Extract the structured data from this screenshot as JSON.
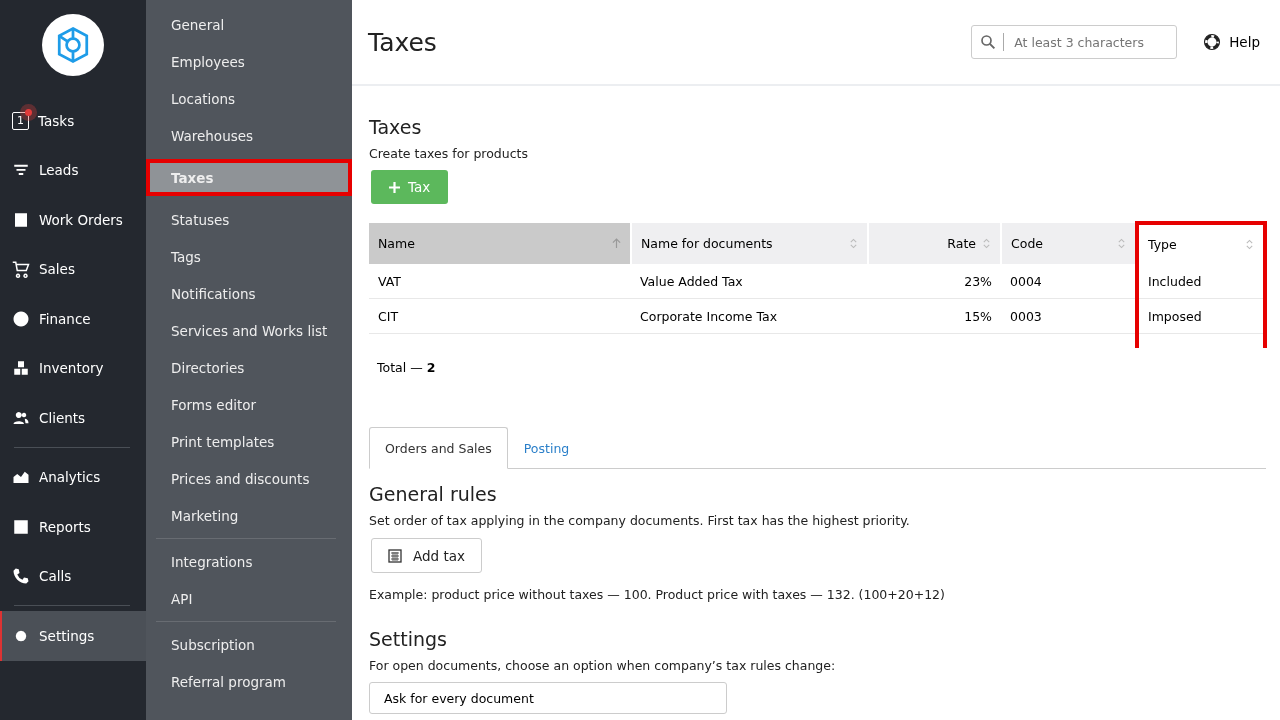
{
  "rail": {
    "items": [
      {
        "label": "Tasks",
        "badge": "1",
        "notification": true,
        "selected": false
      },
      {
        "label": "Leads",
        "selected": false
      },
      {
        "label": "Work Orders",
        "selected": false
      },
      {
        "label": "Sales",
        "selected": false
      },
      {
        "label": "Finance",
        "selected": false
      },
      {
        "label": "Inventory",
        "selected": false
      },
      {
        "label": "Clients",
        "selected": false,
        "divider_after": true
      },
      {
        "label": "Analytics",
        "selected": false
      },
      {
        "label": "Reports",
        "selected": false
      },
      {
        "label": "Calls",
        "selected": false,
        "divider_after": true
      },
      {
        "label": "Settings",
        "selected": true
      }
    ]
  },
  "submenu": {
    "items": [
      {
        "label": "General",
        "selected": false
      },
      {
        "label": "Employees",
        "selected": false
      },
      {
        "label": "Locations",
        "selected": false
      },
      {
        "label": "Warehouses",
        "selected": false
      },
      {
        "label": "Taxes",
        "selected": true,
        "highlighted": true
      },
      {
        "label": "Statuses",
        "selected": false
      },
      {
        "label": "Tags",
        "selected": false
      },
      {
        "label": "Notifications",
        "selected": false
      },
      {
        "label": "Services and Works list",
        "selected": false
      },
      {
        "label": "Directories",
        "selected": false
      },
      {
        "label": "Forms editor",
        "selected": false
      },
      {
        "label": "Print templates",
        "selected": false
      },
      {
        "label": "Prices and discounts",
        "selected": false
      },
      {
        "label": "Marketing",
        "selected": false,
        "divider_after": true
      },
      {
        "label": "Integrations",
        "selected": false
      },
      {
        "label": "API",
        "selected": false,
        "divider_after": true
      },
      {
        "label": "Subscription",
        "selected": false
      },
      {
        "label": "Referral program",
        "selected": false
      }
    ]
  },
  "header": {
    "title": "Taxes",
    "search": {
      "placeholder": "At least 3 characters"
    },
    "help": "Help"
  },
  "taxes": {
    "title": "Taxes",
    "subtitle": "Create taxes for products",
    "add_button": "Tax",
    "table": {
      "columns": [
        {
          "label": "Name",
          "sorted": true,
          "highlighted": false
        },
        {
          "label": "Name for documents",
          "sorted": false,
          "highlighted": false
        },
        {
          "label": "Rate",
          "sorted": false,
          "highlighted": false
        },
        {
          "label": "Code",
          "sorted": false,
          "highlighted": false
        },
        {
          "label": "Type",
          "sorted": false,
          "highlighted": true
        }
      ],
      "rows": [
        [
          "VAT",
          "Value Added Tax",
          "23%",
          "0004",
          "Included"
        ],
        [
          "CIT",
          "Corporate Income Tax",
          "15%",
          "0003",
          "Imposed"
        ]
      ]
    },
    "total": "Total — **2**"
  },
  "tabs": [
    {
      "label": "Orders and Sales",
      "selected": true
    },
    {
      "label": "Posting",
      "selected": false
    }
  ],
  "general_rules": {
    "title": "General rules",
    "description": "Set order of tax applying in the company documents. First tax has the highest priority.",
    "add_button": "Add tax",
    "example": "Example: product price without taxes — 100. Product price with taxes — 132. (100+20+12)"
  },
  "settings": {
    "title": "Settings",
    "description": "For open documents, choose an option when company’s tax rules change:",
    "select": {
      "value": "Ask for every document"
    }
  }
}
